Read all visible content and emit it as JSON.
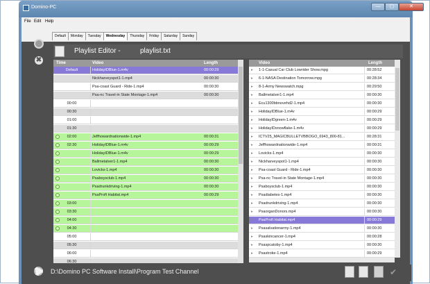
{
  "window": {
    "title": "Domino-PC",
    "min": "—",
    "max": "▢",
    "close": "✕"
  },
  "menu": [
    "File",
    "Edit",
    "Help"
  ],
  "tabs": [
    "Default",
    "Monday",
    "Tuesday",
    "Wednesday",
    "Thursday",
    "Friday",
    "Saturday",
    "Sunday"
  ],
  "active_tab": "Wednesday",
  "editor": {
    "title": "Playlist Editor -",
    "file": "playlist.txt"
  },
  "left_table": {
    "headers": [
      "Time",
      "Video",
      "Length"
    ],
    "rows": [
      {
        "time": "Default",
        "video": "HolidayIDBlue-1.m4v",
        "length": "00:00:29",
        "style": "sel",
        "check": false
      },
      {
        "time": "",
        "video": "Nickharveyspot1-1.mp4",
        "length": "00:00:30",
        "style": "gray",
        "check": false
      },
      {
        "time": "",
        "video": "Psa-coast Guard - Ride-1.mp4",
        "length": "00:00:30",
        "style": "white",
        "check": false
      },
      {
        "time": "",
        "video": "Psa-nc Travel-in State Montage-1.mp4",
        "length": "00:00:30",
        "style": "gray",
        "check": false
      },
      {
        "time": "00:00",
        "video": "",
        "length": "",
        "style": "white",
        "check": false
      },
      {
        "time": "00:30",
        "video": "",
        "length": "",
        "style": "gray",
        "check": false
      },
      {
        "time": "01:00",
        "video": "",
        "length": "",
        "style": "white",
        "check": false
      },
      {
        "time": "01:30",
        "video": "",
        "length": "",
        "style": "gray",
        "check": false
      },
      {
        "time": "02:00",
        "video": "Jeffhowardnationwide-1.mp4",
        "length": "00:00:31",
        "style": "green",
        "check": true
      },
      {
        "time": "02:30",
        "video": "HolidayIDBlue-1.m4v",
        "length": "00:00:29",
        "style": "green",
        "check": true
      },
      {
        "time": "",
        "video": "HolidayIDBlue-1.m4v",
        "length": "00:00:29",
        "style": "green",
        "check": true
      },
      {
        "time": "",
        "video": "Ballmetalver1-1.mp4",
        "length": "00:00:30",
        "style": "green",
        "check": true
      },
      {
        "time": "",
        "video": "Lovicks-1.mp4",
        "length": "00:00:30",
        "style": "green",
        "check": true
      },
      {
        "time": "",
        "video": "Psaboysclub-1.mp4",
        "length": "00:00:30",
        "style": "green",
        "check": true
      },
      {
        "time": "",
        "video": "Psadrunkdriving-1.mp4",
        "length": "00:00:30",
        "style": "green",
        "check": true
      },
      {
        "time": "",
        "video": "PsaProft Habitat.mp4",
        "length": "00:00:29",
        "style": "green",
        "check": true
      },
      {
        "time": "03:00",
        "video": "",
        "length": "",
        "style": "green",
        "check": true
      },
      {
        "time": "03:30",
        "video": "",
        "length": "",
        "style": "green",
        "check": true
      },
      {
        "time": "04:00",
        "video": "",
        "length": "",
        "style": "green",
        "check": true
      },
      {
        "time": "04:30",
        "video": "",
        "length": "",
        "style": "green",
        "check": true
      },
      {
        "time": "05:00",
        "video": "",
        "length": "",
        "style": "white",
        "check": false
      },
      {
        "time": "05:30",
        "video": "",
        "length": "",
        "style": "gray",
        "check": false
      },
      {
        "time": "06:00",
        "video": "",
        "length": "",
        "style": "white",
        "check": false
      },
      {
        "time": "06:30",
        "video": "",
        "length": "",
        "style": "gray",
        "check": false
      }
    ]
  },
  "right_table": {
    "headers": [
      "Video",
      "Length"
    ],
    "rows": [
      {
        "video": "1-1-Casual Car Club Lowrider Show.mpg",
        "length": "00:28:52",
        "style": "white"
      },
      {
        "video": "6-1-NASA Destination Tomorrow.mpg",
        "length": "00:28:34",
        "style": "white"
      },
      {
        "video": "8-1-Army Newswatch.mpg",
        "length": "00:29:50",
        "style": "white"
      },
      {
        "video": "Ballmetalver1-1.mp4",
        "length": "00:00:30",
        "style": "white"
      },
      {
        "video": "Ecu1300bbnovehd2-1.mp4",
        "length": "00:00:30",
        "style": "white"
      },
      {
        "video": "HolidayIDBlue-1.m4v",
        "length": "00:00:29",
        "style": "white"
      },
      {
        "video": "HolidayIDgreen-1.m4v",
        "length": "00:00:29",
        "style": "white"
      },
      {
        "video": "HolidayIDsnowflake-1.m4v",
        "length": "00:00:29",
        "style": "white"
      },
      {
        "video": "ICTV25_MAGICBULLETVBBOGO_6943_800-81...",
        "length": "00:28:31",
        "style": "white"
      },
      {
        "video": "Jeffhowardnationwide-1.mp4",
        "length": "00:00:31",
        "style": "white"
      },
      {
        "video": "Lovicks-1.mp4",
        "length": "00:00:30",
        "style": "white"
      },
      {
        "video": "Nickharveyspot1-1.mp4",
        "length": "00:00:30",
        "style": "white"
      },
      {
        "video": "Psa-coast Guard - Ride-1.mp4",
        "length": "00:00:30",
        "style": "white"
      },
      {
        "video": "Psa-nc Travel-in State Montage-1.mp4",
        "length": "00:00:30",
        "style": "white"
      },
      {
        "video": "Psaboysclub-1.mp4",
        "length": "00:00:30",
        "style": "white"
      },
      {
        "video": "Psadiabetes-1.mp4",
        "length": "00:00:30",
        "style": "white"
      },
      {
        "video": "Psadrunkdriving-1.mp4",
        "length": "00:00:30",
        "style": "white"
      },
      {
        "video": "PsaorganDonors.mp4",
        "length": "00:00:30",
        "style": "white"
      },
      {
        "video": "PsaProft Habitat.mp4",
        "length": "00:00:29",
        "style": "sel"
      },
      {
        "video": "Psasalvationarmy-1.mp4",
        "length": "00:00:30",
        "style": "white"
      },
      {
        "video": "Psaskincancer-1.mp4",
        "length": "00:00:28",
        "style": "white"
      },
      {
        "video": "Psaspcatoby-1.mp4",
        "length": "00:00:30",
        "style": "white"
      },
      {
        "video": "Psastroke-1.mp4",
        "length": "00:00:29",
        "style": "white"
      }
    ]
  },
  "status": {
    "path": "D:\\Domino PC Software Install\\Program Test Channel"
  },
  "colors": {
    "selection": "#8779d8",
    "scheduled": "#b6f59a",
    "workarea": "#4e4e4e"
  },
  "icons": [
    "settings-icon",
    "close-circle-icon",
    "playlist-icon",
    "gear-icon",
    "new-document-icon",
    "open-document-icon",
    "save-icon",
    "check-icon",
    "play-arrow-icon"
  ]
}
